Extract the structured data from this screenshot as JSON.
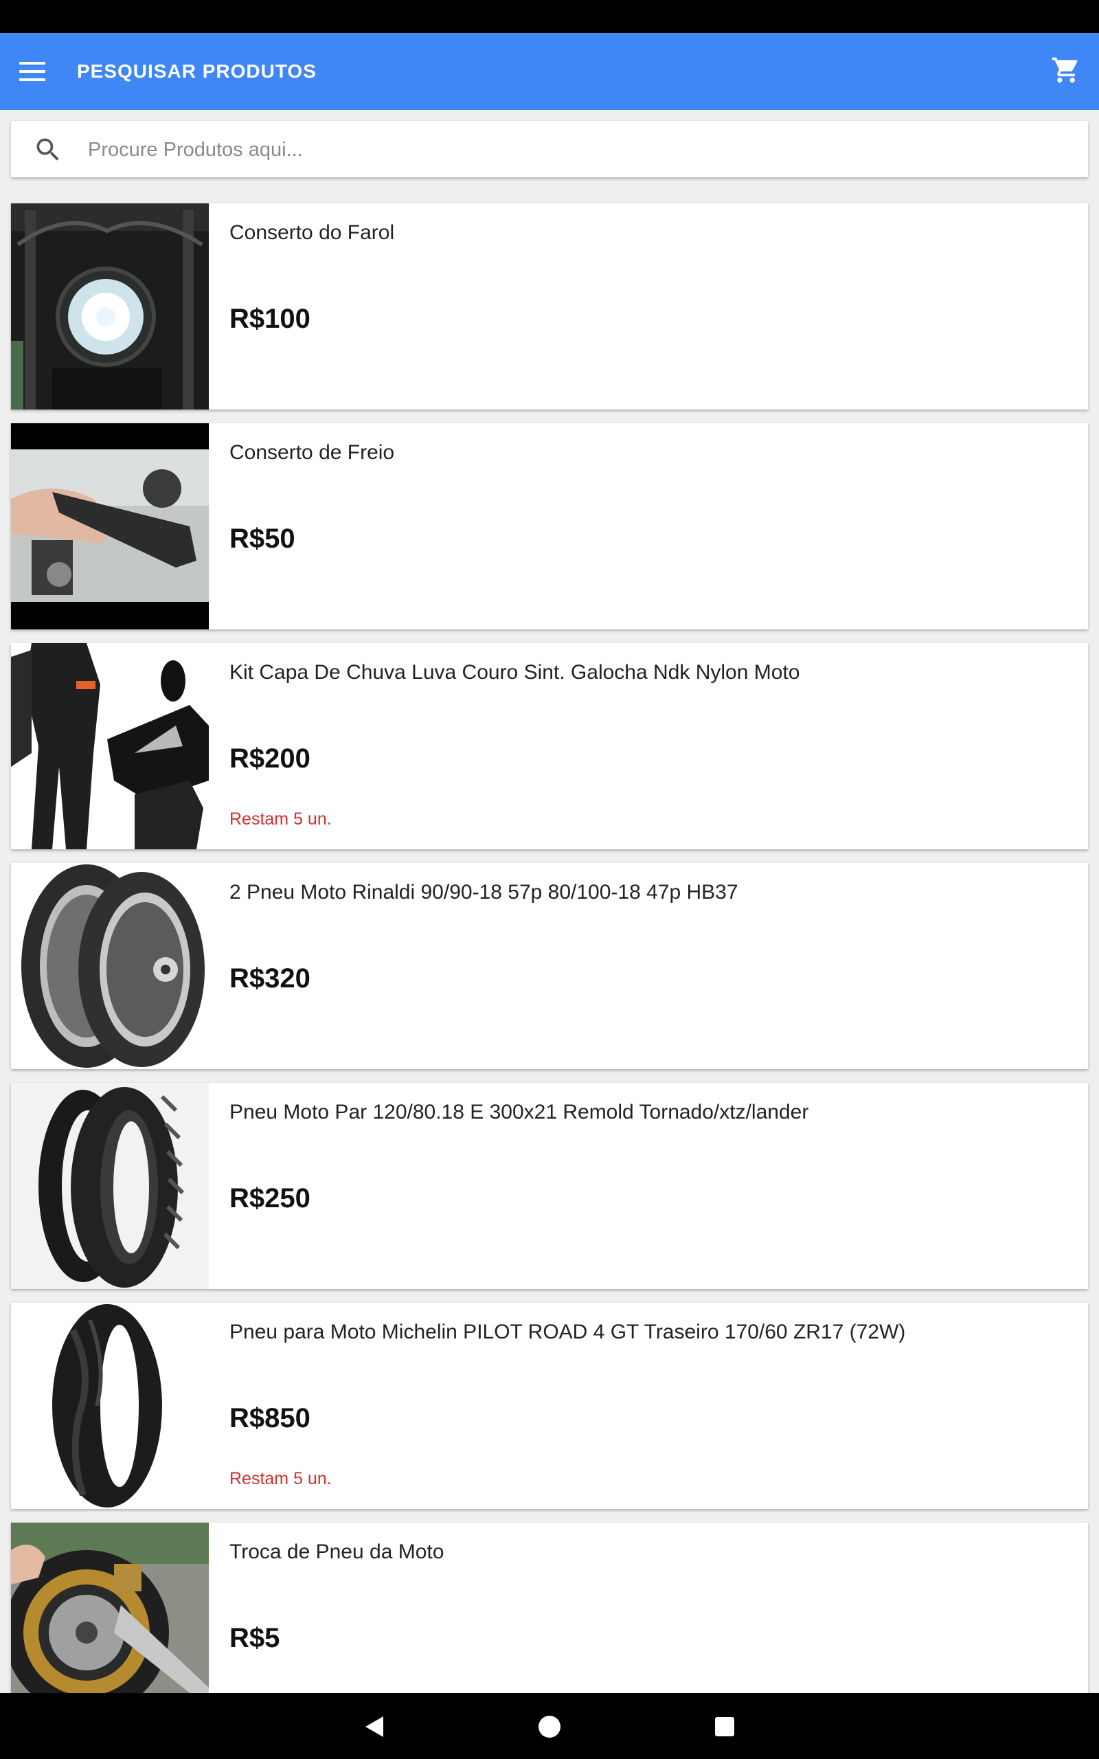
{
  "app_bar": {
    "title": "PESQUISAR PRODUTOS",
    "menu_icon": "hamburger-menu-icon",
    "cart_icon": "shopping-cart-icon"
  },
  "search": {
    "placeholder": "Procure Produtos aqui...",
    "value": "",
    "icon": "search-icon"
  },
  "products": [
    {
      "name": "Conserto do Farol",
      "price": "R$100",
      "stock": ""
    },
    {
      "name": "Conserto de Freio",
      "price": "R$50",
      "stock": ""
    },
    {
      "name": "Kit Capa De Chuva Luva Couro Sint. Galocha Ndk Nylon Moto",
      "price": "R$200",
      "stock": "Restam 5 un."
    },
    {
      "name": "2 Pneu Moto Rinaldi 90/90-18 57p 80/100-18 47p HB37",
      "price": "R$320",
      "stock": ""
    },
    {
      "name": "Pneu Moto Par 120/80.18 E 300x21 Remold Tornado/xtz/lander",
      "price": "R$250",
      "stock": ""
    },
    {
      "name": "Pneu para Moto Michelin PILOT ROAD 4 GT Traseiro 170/60 ZR17 (72W)",
      "price": "R$850",
      "stock": "Restam 5 un."
    },
    {
      "name": "Troca de Pneu da Moto",
      "price": "R$5",
      "stock": ""
    }
  ],
  "colors": {
    "app_bar": "#3f86f7",
    "stock_warning": "#d32f2f",
    "background": "#efefef"
  },
  "nav": {
    "back_icon": "back-triangle-icon",
    "home_icon": "home-circle-icon",
    "recents_icon": "recents-square-icon"
  }
}
